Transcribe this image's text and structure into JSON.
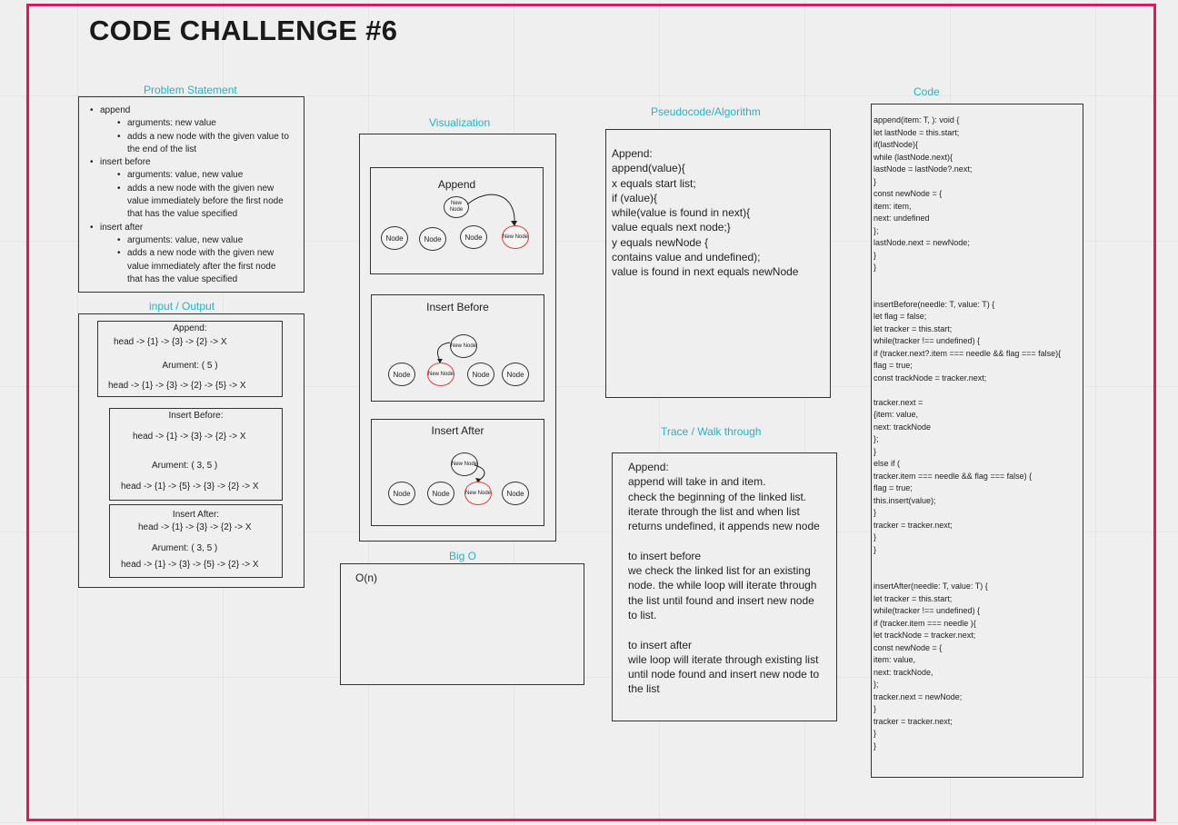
{
  "title": "CODE CHALLENGE #6",
  "labels": {
    "problem": "Problem Statement",
    "io": "input / Output",
    "visualization": "Visualization",
    "pseudocode": "Pseudocode/Algorithm",
    "code": "Code",
    "trace": "Trace / Walk through",
    "bigo": "Big O"
  },
  "problem_items": [
    {
      "level": 1,
      "text": "append"
    },
    {
      "level": 2,
      "text": "arguments: new value"
    },
    {
      "level": 2,
      "text": "adds a new node with the given value to"
    },
    {
      "level": 3,
      "text": "the end of the list"
    },
    {
      "level": 1,
      "text": "insert before"
    },
    {
      "level": 2,
      "text": "arguments: value, new value"
    },
    {
      "level": 2,
      "text": "adds a new node with the given new"
    },
    {
      "level": 3,
      "text": "value immediately before the first node"
    },
    {
      "level": 3,
      "text": "that has the value specified"
    },
    {
      "level": 1,
      "text": "insert after"
    },
    {
      "level": 2,
      "text": "arguments: value, new value"
    },
    {
      "level": 2,
      "text": "adds a new node with the given new"
    },
    {
      "level": 3,
      "text": "value immediately after the first node"
    },
    {
      "level": 3,
      "text": "that has the value specified"
    }
  ],
  "io": {
    "append": {
      "title": "Append:",
      "head": "head -> {1} -> {3} -> {2} -> X",
      "arg": "Arument: ( 5 )",
      "result": "head -> {1} -> {3} -> {2} -> {5} -> X"
    },
    "before": {
      "title": "Insert Before:",
      "head": "head -> {1} -> {3} -> {2} -> X",
      "arg": "Arument: ( 3, 5 )",
      "result": "head -> {1} -> {5} -> {3} -> {2} -> X"
    },
    "after": {
      "title": "Insert After:",
      "head": "head -> {1} -> {3} -> {2} -> X",
      "arg": "Arument: ( 3, 5 )",
      "result": "head -> {1} -> {3} -> {5} -> {2} -> X"
    }
  },
  "viz": {
    "append_title": "Append",
    "before_title": "Insert Before",
    "after_title": "Insert After",
    "node": "Node",
    "new_node": "New Node"
  },
  "pseudocode": [
    "Append:",
    "append(value){",
    "x equals start list;",
    "if (value){",
    "while(value is found in next){",
    "value equals next node;}",
    "y equals newNode {",
    "contains value and undefined);",
    "value is found in next equals newNode"
  ],
  "trace": [
    "Append:",
    "append will take in and item.",
    "check the beginning of the linked list.",
    "iterate through the list and when list",
    "returns undefined, it appends new node",
    "",
    "to insert before",
    "we check the linked list for an existing",
    "node. the while loop will iterate through",
    "the list until found and insert new node",
    "to list.",
    "",
    "to insert after",
    "wile loop will iterate through existing list",
    "until node found and insert new node to",
    "the list"
  ],
  "bigo": "O(n)",
  "code": [
    "append(item: T, ): void {",
    "  let lastNode = this.start;",
    "  if(lastNode){",
    "    while (lastNode.next){",
    "      lastNode = lastNode?.next;",
    "    }",
    "    const newNode = {",
    "      item: item,",
    "      next: undefined",
    "    };",
    "    lastNode.next = newNode;",
    "  }",
    "}",
    "",
    "",
    " insertBefore(needle: T, value: T) {",
    "   let flag = false;",
    "   let tracker = this.start;",
    "   while(tracker !== undefined) {",
    "   if (tracker.next?.item === needle && flag === false){",
    "     flag = true;",
    "     const trackNode = tracker.next;",
    "",
    "      tracker.next =",
    "        {item: value,",
    "          next: trackNode",
    "        };",
    "      }",
    "        else if (",
    "          tracker.item === needle && flag === false) {",
    "            flag = true;",
    "            this.insert(value);",
    "          }",
    "   tracker = tracker.next;",
    "   }",
    " }",
    "",
    "",
    " insertAfter(needle: T, value: T) {",
    "   let tracker = this.start;",
    " while(tracker !== undefined) {",
    "   if (tracker.item === needle ){",
    "     let trackNode = tracker.next;",
    "       const newNode = {",
    "         item: value,",
    "         next: trackNode,",
    "       };",
    "       tracker.next = newNode;",
    "   }",
    "   tracker = tracker.next;",
    " }",
    " }"
  ]
}
